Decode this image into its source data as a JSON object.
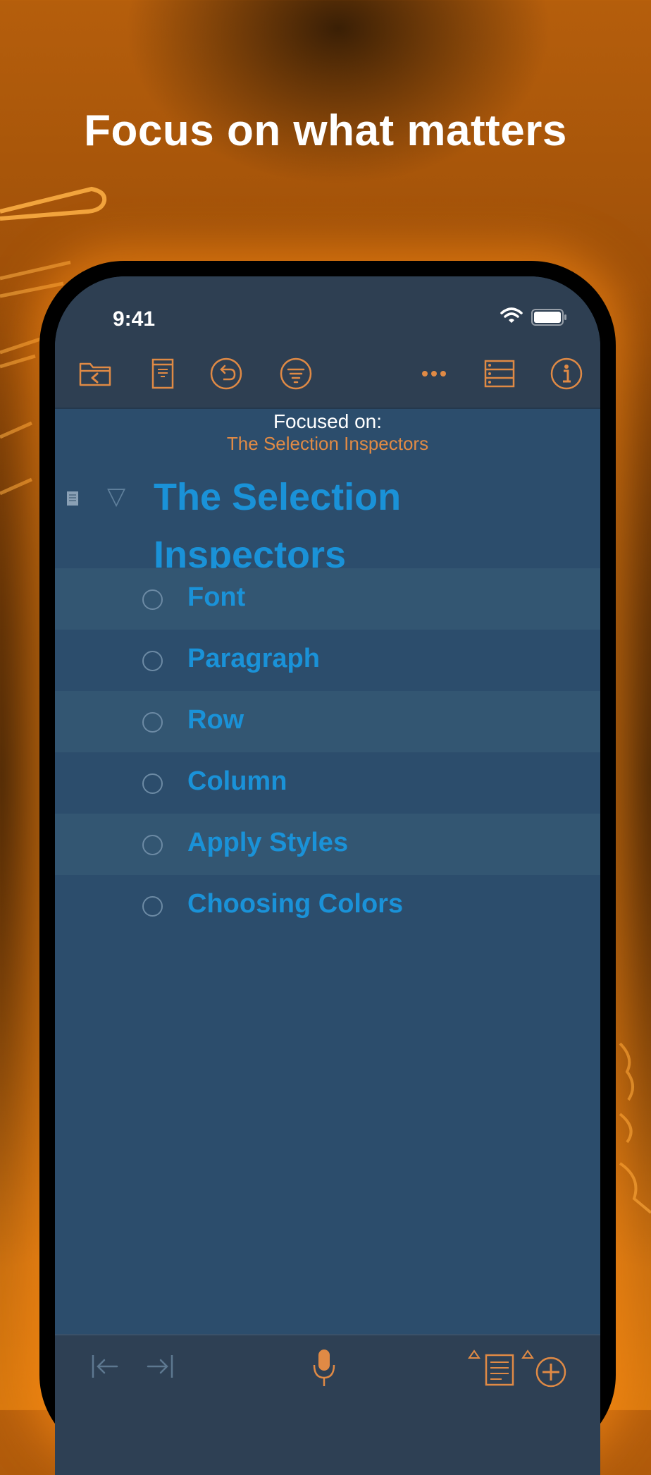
{
  "headline": "Focus on what matters",
  "status": {
    "time": "9:41"
  },
  "toolbar": {
    "buttons": [
      "folder-back",
      "archive",
      "undo",
      "filter",
      "more",
      "outline-view",
      "info"
    ]
  },
  "focus": {
    "label": "Focused on:",
    "target": "The Selection Inspectors"
  },
  "outline": {
    "title": "The Selection Inspectors",
    "rows": [
      {
        "label": "Font",
        "shaded": true
      },
      {
        "label": "Paragraph",
        "shaded": false
      },
      {
        "label": "Row",
        "shaded": true
      },
      {
        "label": "Column",
        "shaded": false
      },
      {
        "label": "Apply Styles",
        "shaded": true
      },
      {
        "label": "Choosing Colors",
        "shaded": false
      }
    ]
  },
  "colors": {
    "accent": "#e08a45",
    "row_text": "#1a92d8",
    "screen_bg": "#2c4d6c",
    "toolbar_bg": "#2e3f52"
  }
}
